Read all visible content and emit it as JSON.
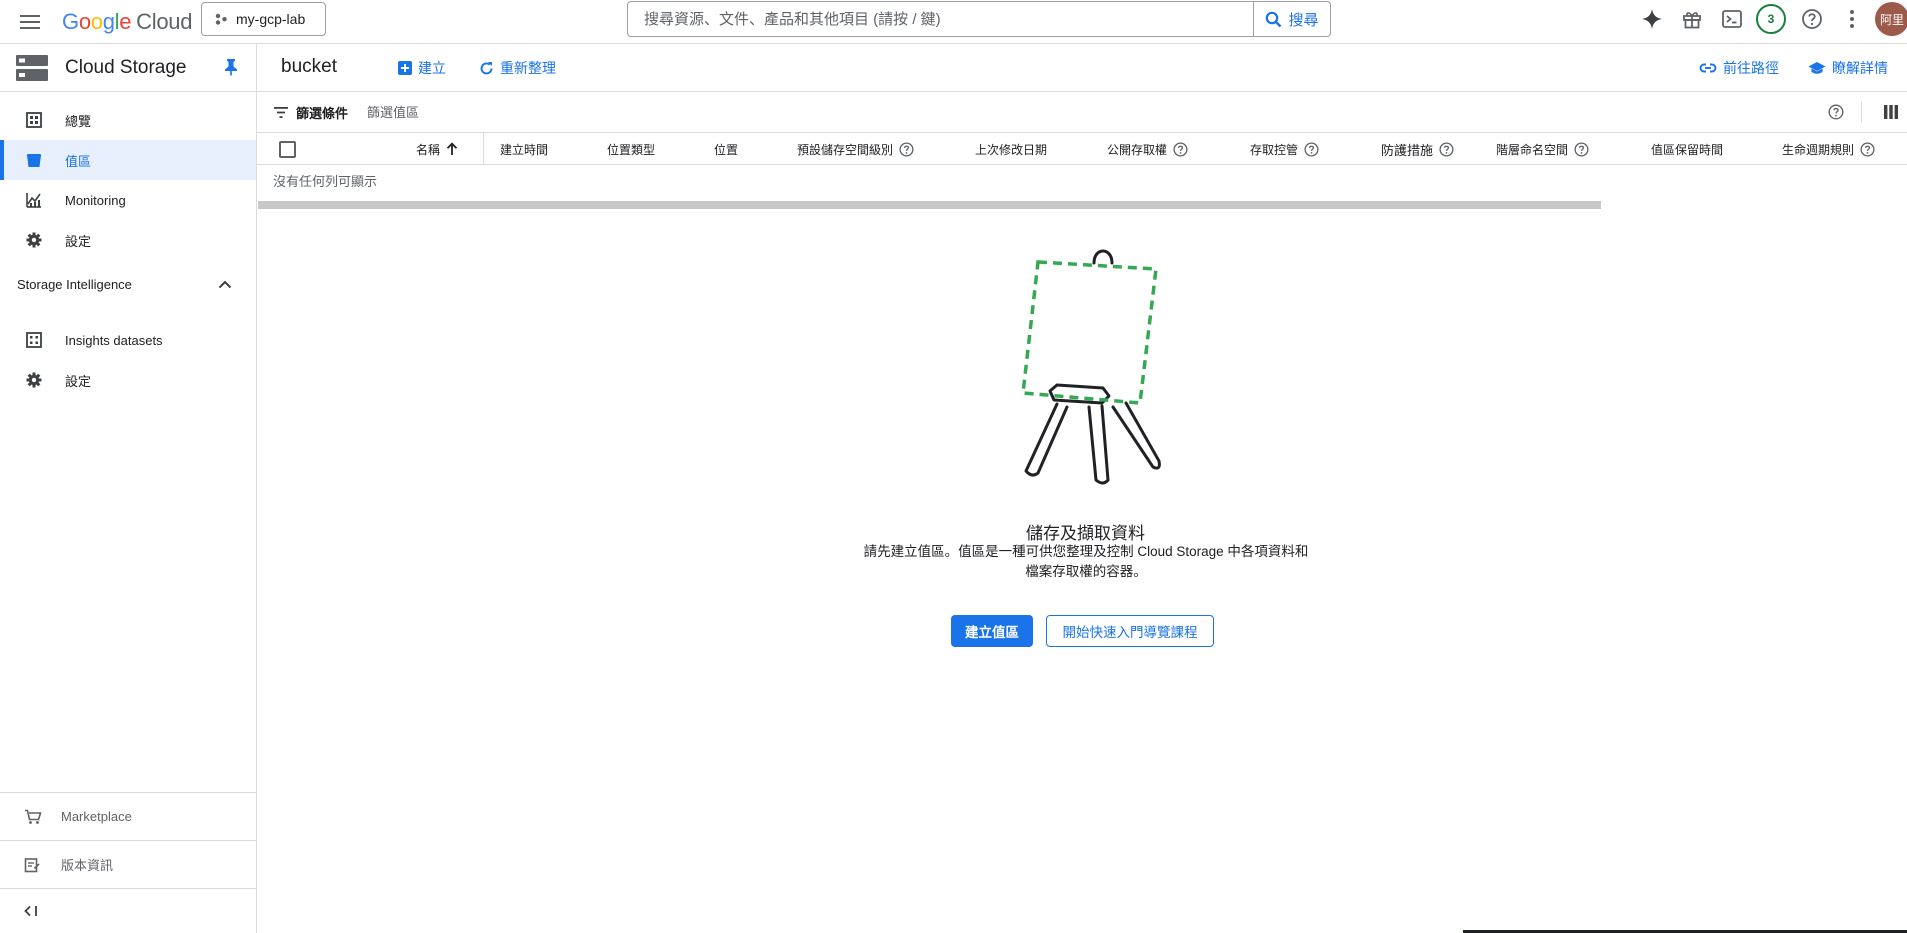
{
  "topbar": {
    "logo_google": "Google",
    "logo_cloud": "Cloud",
    "project_name": "my-gcp-lab",
    "search_placeholder": "搜尋資源、文件、產品和其他項目 (請按 / 鍵)",
    "search_button": "搜尋",
    "notifications_count": "3",
    "avatar_text": "阿里"
  },
  "sidebar": {
    "product_name": "Cloud Storage",
    "items": [
      {
        "label": "總覽",
        "icon": "overview-icon"
      },
      {
        "label": "值區",
        "icon": "bucket-icon",
        "active": true
      },
      {
        "label": "Monitoring",
        "icon": "monitoring-icon"
      },
      {
        "label": "設定",
        "icon": "settings-icon"
      }
    ],
    "section_title": "Storage Intelligence",
    "section_items": [
      {
        "label": "Insights datasets",
        "icon": "dataset-icon"
      },
      {
        "label": "設定",
        "icon": "settings-icon"
      }
    ],
    "footer_items": [
      {
        "label": "Marketplace",
        "icon": "marketplace-icon"
      },
      {
        "label": "版本資訊",
        "icon": "release-notes-icon"
      }
    ]
  },
  "header": {
    "title": "bucket",
    "create_label": "建立",
    "refresh_label": "重新整理",
    "path_label": "前往路徑",
    "learn_label": "瞭解詳情"
  },
  "filter": {
    "label": "篩選條件",
    "placeholder": "篩選值區"
  },
  "table": {
    "columns": [
      "名稱",
      "建立時間",
      "位置類型",
      "位置",
      "預設儲存空間級別",
      "上次修改日期",
      "公開存取權",
      "存取控管",
      "防護措施",
      "階層命名空間",
      "值區保留時間",
      "生命週期規則"
    ],
    "empty_text": "沒有任何列可顯示"
  },
  "empty_state": {
    "title": "儲存及擷取資料",
    "description_line1": "請先建立值區。值區是一種可供您整理及控制 Cloud Storage 中各項資料和",
    "description_line2": "檔案存取權的容器。",
    "primary_button": "建立值區",
    "secondary_button": "開始快速入門導覽課程"
  },
  "colors": {
    "accent": "#1a73e8",
    "active_bg": "#e8f0fe",
    "illustration_green": "#34a853"
  }
}
